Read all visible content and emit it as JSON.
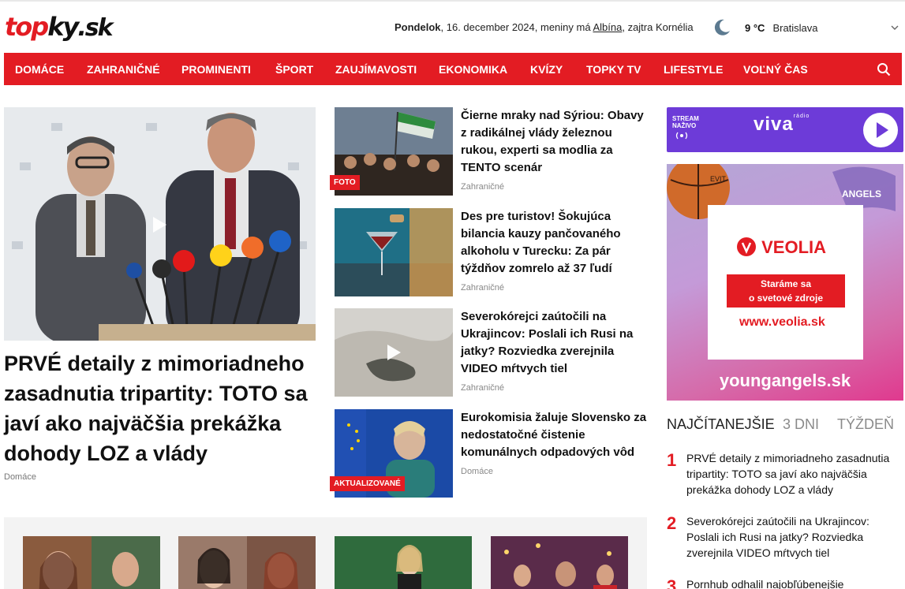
{
  "header": {
    "logo": {
      "part1": "top",
      "part2": "ky",
      "part3": ".sk"
    },
    "date_day": "Pondelok",
    "date_rest": ", 16. december 2024, meniny má ",
    "nameday": "Albína",
    "tomorrow": ", zajtra Kornélia",
    "weather": {
      "temp": "9 °C",
      "city": "Bratislava",
      "icon": "moon-icon"
    }
  },
  "nav": {
    "items": [
      "DOMÁCE",
      "ZAHRANIČNÉ",
      "PROMINENTI",
      "ŠPORT",
      "ZAUJÍMAVOSTI",
      "EKONOMIKA",
      "KVÍZY",
      "TOPKY TV",
      "LIFESTYLE",
      "VOĽNÝ ČAS"
    ],
    "search_icon": "search-icon"
  },
  "lead": {
    "headline": "PRVÉ detaily z mimoriadneho zasadnutia tripartity: TOTO sa javí ako najväčšia prekážka dohody LOZ a vlády",
    "category": "Domáce"
  },
  "articles": [
    {
      "title": "Čierne mraky nad Sýriou: Obavy z radikálnej vlády železnou rukou, experti sa modlia za TENTO scenár",
      "category": "Zahraničné",
      "badge": "FOTO"
    },
    {
      "title": "Des pre turistov! Šokujúca bilancia kauzy pančovaného alkoholu v Turecku: Za pár týždňov zomrelo až 37 ľudí",
      "category": "Zahraničné",
      "badge": ""
    },
    {
      "title": "Severokórejci zaútočili na Ukrajincov: Poslali ich Rusi na jatky? Rozviedka zverejnila VIDEO mŕtvych tiel",
      "category": "Zahraničné",
      "badge": ""
    },
    {
      "title": "Eurokomisia žaluje Slovensko za nedostatočné čistenie komunálnych odpadových vôd",
      "category": "Domáce",
      "badge": "AKTUALIZOVANÉ"
    }
  ],
  "radio": {
    "stream_line1": "STREAM",
    "stream_line2": "NAŽIVO",
    "brand": "viva",
    "brand_sub": "rádio"
  },
  "ad": {
    "brand": "VEOLIA",
    "slogan_line1": "Staráme sa",
    "slogan_line2": "o svetové zdroje",
    "url": "www.veolia.sk",
    "site": "youngangels.sk",
    "ball_brand": "EVIT",
    "sponsor_mark": "ANGELS"
  },
  "most_read": {
    "tabs": [
      "NAJČÍTANEJŠIE",
      "3 DNI",
      "TÝŽDEŇ"
    ],
    "items": [
      {
        "rank": "1",
        "title": "PRVÉ detaily z mimoriadneho zasadnutia tripartity: TOTO sa javí ako najväčšia prekážka dohody LOZ a vlády"
      },
      {
        "rank": "2",
        "title": "Severokórejci zaútočili na Ukrajincov: Poslali ich Rusi na jatky? Rozviedka zverejnila VIDEO mŕtvych tiel"
      },
      {
        "rank": "3",
        "title": "Pornhub odhalil najobľúbenejšie"
      }
    ]
  },
  "colors": {
    "brand_red": "#e31c23",
    "radio_purple": "#6d3bd8"
  }
}
